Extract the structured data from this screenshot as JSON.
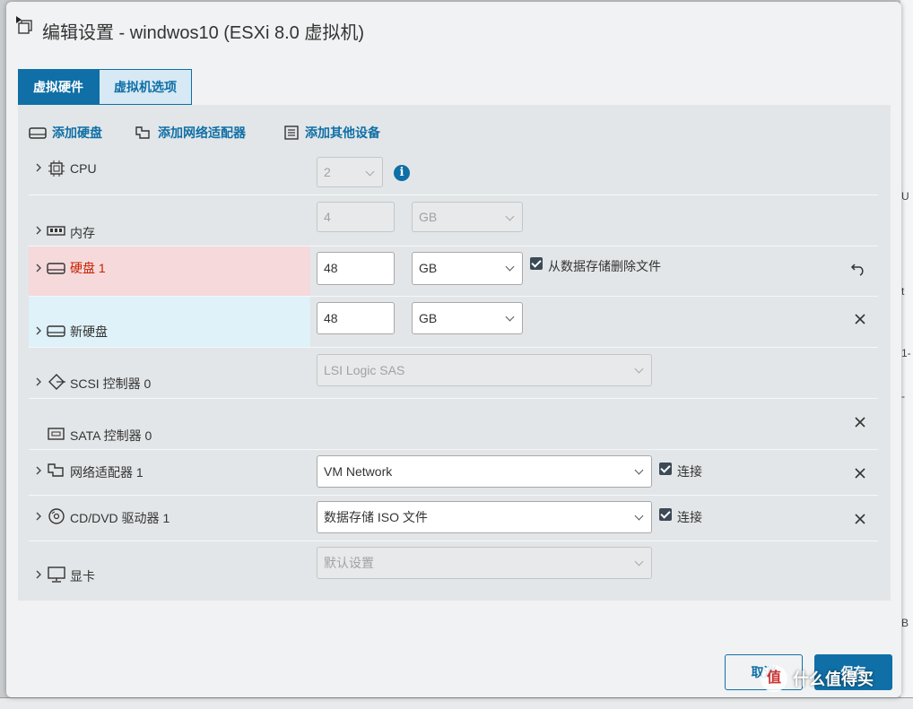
{
  "dialog": {
    "title": "编辑设置 - windwos10 (ESXi 8.0 虚拟机)"
  },
  "tabs": [
    {
      "label": "虚拟硬件",
      "active": true
    },
    {
      "label": "虚拟机选项",
      "active": false
    }
  ],
  "toolbar": {
    "add_disk": "添加硬盘",
    "add_network": "添加网络适配器",
    "add_other": "添加其他设备"
  },
  "rows": {
    "cpu": {
      "label": "CPU",
      "value": "2"
    },
    "memory": {
      "label": "内存",
      "value": "4",
      "unit": "GB"
    },
    "disk1": {
      "label": "硬盘 1",
      "value": "48",
      "unit": "GB",
      "checkbox_label": "从数据存储删除文件"
    },
    "newdisk": {
      "label": "新硬盘",
      "value": "48",
      "unit": "GB"
    },
    "scsi": {
      "label": "SCSI 控制器 0",
      "value": "LSI Logic SAS"
    },
    "sata": {
      "label": "SATA 控制器 0"
    },
    "network": {
      "label": "网络适配器 1",
      "value": "VM Network",
      "checkbox_label": "连接"
    },
    "cddvd": {
      "label": "CD/DVD 驱动器 1",
      "value": "数据存储 ISO 文件",
      "checkbox_label": "连接"
    },
    "display": {
      "label": "显卡",
      "value": "默认设置"
    }
  },
  "footer": {
    "cancel": "取消",
    "save": "保存"
  },
  "watermark": {
    "symbol": "值",
    "text": "什么值得买"
  },
  "colors": {
    "accent": "#0f6fa6",
    "highlight_red": "#f5d9db",
    "highlight_blue": "#dff1f9",
    "error_text": "#c92100"
  }
}
